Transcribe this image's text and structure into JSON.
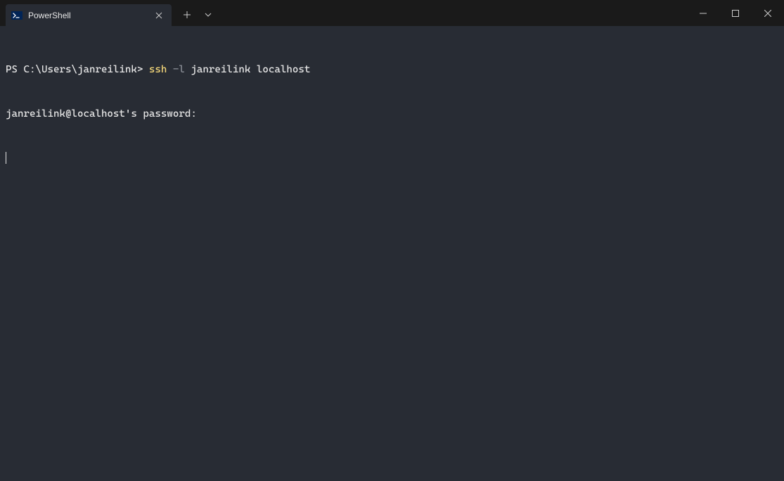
{
  "tab": {
    "title": "PowerShell",
    "icon": "powershell-icon"
  },
  "terminal": {
    "line1": {
      "prompt": "PS C:\\Users\\janreilink> ",
      "command": "ssh",
      "flag": " -l",
      "args": " janreilink localhost"
    },
    "line2": "janreilink@localhost's password:"
  },
  "colors": {
    "background": "#282c34",
    "titlebarBg": "#1a1a1a",
    "text": "#e6e6e6",
    "commandHighlight": "#f5d87a",
    "flagHighlight": "#8a8e96"
  }
}
